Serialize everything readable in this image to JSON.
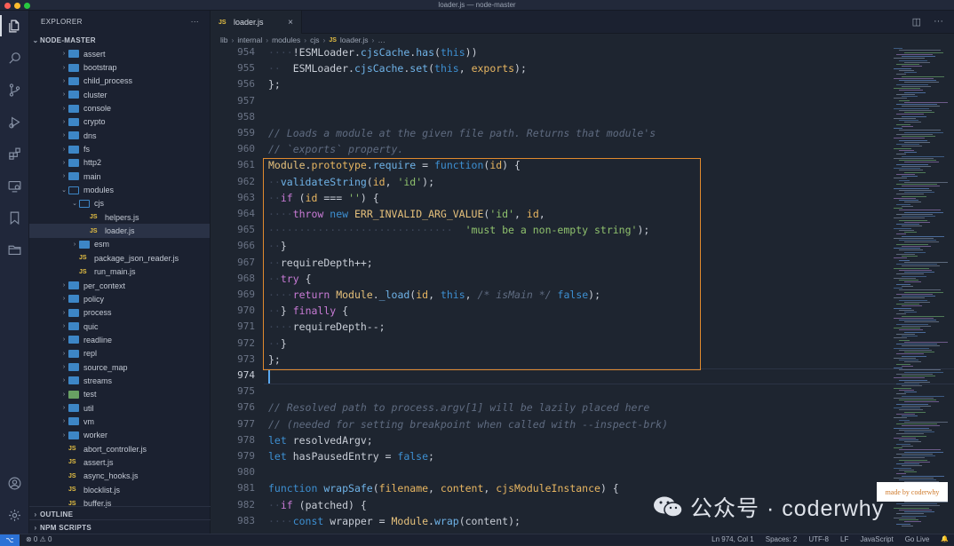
{
  "window": {
    "title": "loader.js — node-master"
  },
  "activity_bar": [
    {
      "icon": "files-icon",
      "active": true
    },
    {
      "icon": "search-icon"
    },
    {
      "icon": "source-control-icon"
    },
    {
      "icon": "run-debug-icon"
    },
    {
      "icon": "extensions-icon"
    },
    {
      "icon": "remote-explorer-icon"
    },
    {
      "icon": "bookmark-icon"
    },
    {
      "icon": "folder-icon"
    },
    {
      "icon": "account-icon"
    },
    {
      "icon": "settings-gear-icon"
    }
  ],
  "sidebar": {
    "title": "EXPLORER",
    "more": "···",
    "root": "NODE-MASTER",
    "outline": "OUTLINE",
    "npm_scripts": "NPM SCRIPTS",
    "tree": [
      {
        "label": "assert",
        "type": "folder",
        "depth": 1,
        "open": false
      },
      {
        "label": "bootstrap",
        "type": "folder",
        "depth": 1,
        "open": false
      },
      {
        "label": "child_process",
        "type": "folder",
        "depth": 1,
        "open": false
      },
      {
        "label": "cluster",
        "type": "folder",
        "depth": 1,
        "open": false
      },
      {
        "label": "console",
        "type": "folder",
        "depth": 1,
        "open": false
      },
      {
        "label": "crypto",
        "type": "folder",
        "depth": 1,
        "open": false
      },
      {
        "label": "dns",
        "type": "folder",
        "depth": 1,
        "open": false
      },
      {
        "label": "fs",
        "type": "folder",
        "depth": 1,
        "open": false
      },
      {
        "label": "http2",
        "type": "folder",
        "depth": 1,
        "open": false
      },
      {
        "label": "main",
        "type": "folder",
        "depth": 1,
        "open": false
      },
      {
        "label": "modules",
        "type": "folder",
        "depth": 1,
        "open": true
      },
      {
        "label": "cjs",
        "type": "folder",
        "depth": 2,
        "open": true
      },
      {
        "label": "helpers.js",
        "type": "js",
        "depth": 3
      },
      {
        "label": "loader.js",
        "type": "js",
        "depth": 3,
        "selected": true
      },
      {
        "label": "esm",
        "type": "folder",
        "depth": 2,
        "open": false
      },
      {
        "label": "package_json_reader.js",
        "type": "js",
        "depth": 2
      },
      {
        "label": "run_main.js",
        "type": "js",
        "depth": 2
      },
      {
        "label": "per_context",
        "type": "folder",
        "depth": 1,
        "open": false
      },
      {
        "label": "policy",
        "type": "folder",
        "depth": 1,
        "open": false
      },
      {
        "label": "process",
        "type": "folder",
        "depth": 1,
        "open": false
      },
      {
        "label": "quic",
        "type": "folder",
        "depth": 1,
        "open": false
      },
      {
        "label": "readline",
        "type": "folder",
        "depth": 1,
        "open": false
      },
      {
        "label": "repl",
        "type": "folder",
        "depth": 1,
        "open": false
      },
      {
        "label": "source_map",
        "type": "folder",
        "depth": 1,
        "open": false
      },
      {
        "label": "streams",
        "type": "folder",
        "depth": 1,
        "open": false
      },
      {
        "label": "test",
        "type": "testfolder",
        "depth": 1,
        "open": false
      },
      {
        "label": "util",
        "type": "folder",
        "depth": 1,
        "open": false
      },
      {
        "label": "vm",
        "type": "folder",
        "depth": 1,
        "open": false
      },
      {
        "label": "worker",
        "type": "folder",
        "depth": 1,
        "open": false
      },
      {
        "label": "abort_controller.js",
        "type": "js",
        "depth": 1
      },
      {
        "label": "assert.js",
        "type": "js",
        "depth": 1
      },
      {
        "label": "async_hooks.js",
        "type": "js",
        "depth": 1
      },
      {
        "label": "blocklist.js",
        "type": "js",
        "depth": 1
      },
      {
        "label": "buffer.js",
        "type": "js",
        "depth": 1
      }
    ]
  },
  "tab": {
    "badge": "JS",
    "label": "loader.js",
    "close": "×"
  },
  "breadcrumb": [
    "lib",
    "internal",
    "modules",
    "cjs",
    "JS",
    "loader.js",
    "…"
  ],
  "editor": {
    "lines": [
      {
        "n": "954",
        "tokens": [
          [
            "dot",
            "····"
          ],
          [
            "p",
            "!"
          ],
          [
            "p",
            "ESMLoader"
          ],
          [
            "p",
            "."
          ],
          [
            "fn",
            "cjsCache"
          ],
          [
            "p",
            "."
          ],
          [
            "fn",
            "has"
          ],
          [
            "p",
            "("
          ],
          [
            "kw",
            "this"
          ],
          [
            "p",
            "))"
          ]
        ]
      },
      {
        "n": "955",
        "tokens": [
          [
            "dot",
            "··"
          ],
          [
            "p",
            "  ESMLoader"
          ],
          [
            "p",
            "."
          ],
          [
            "fn",
            "cjsCache"
          ],
          [
            "p",
            "."
          ],
          [
            "fn",
            "set"
          ],
          [
            "p",
            "("
          ],
          [
            "kw",
            "this"
          ],
          [
            "p",
            ", "
          ],
          [
            "pr",
            "exports"
          ],
          [
            "p",
            ");"
          ]
        ]
      },
      {
        "n": "956",
        "tokens": [
          [
            "p",
            "};"
          ]
        ]
      },
      {
        "n": "957",
        "tokens": []
      },
      {
        "n": "958",
        "tokens": []
      },
      {
        "n": "959",
        "tokens": [
          [
            "cm",
            "// Loads a module at the given file path. Returns that module's"
          ]
        ]
      },
      {
        "n": "960",
        "tokens": [
          [
            "cm",
            "// `exports` property."
          ]
        ]
      },
      {
        "n": "961",
        "tokens": [
          [
            "cls",
            "Module"
          ],
          [
            "p",
            "."
          ],
          [
            "pr",
            "prototype"
          ],
          [
            "p",
            "."
          ],
          [
            "fn",
            "require"
          ],
          [
            "p",
            " = "
          ],
          [
            "kw",
            "function"
          ],
          [
            "p",
            "("
          ],
          [
            "pr",
            "id"
          ],
          [
            "p",
            ") {"
          ]
        ]
      },
      {
        "n": "962",
        "tokens": [
          [
            "dot",
            "··"
          ],
          [
            "fn",
            "validateString"
          ],
          [
            "p",
            "("
          ],
          [
            "pr",
            "id"
          ],
          [
            "p",
            ", "
          ],
          [
            "str",
            "'id'"
          ],
          [
            "p",
            ");"
          ]
        ]
      },
      {
        "n": "963",
        "tokens": [
          [
            "dot",
            "··"
          ],
          [
            "ctl",
            "if"
          ],
          [
            "p",
            " ("
          ],
          [
            "pr",
            "id"
          ],
          [
            "p",
            " === "
          ],
          [
            "str",
            "''"
          ],
          [
            "p",
            ") {"
          ]
        ]
      },
      {
        "n": "964",
        "tokens": [
          [
            "dot",
            "····"
          ],
          [
            "ctl",
            "throw"
          ],
          [
            "p",
            " "
          ],
          [
            "kw",
            "new"
          ],
          [
            "p",
            " "
          ],
          [
            "cls",
            "ERR_INVALID_ARG_VALUE"
          ],
          [
            "p",
            "("
          ],
          [
            "str",
            "'id'"
          ],
          [
            "p",
            ", "
          ],
          [
            "pr",
            "id"
          ],
          [
            "p",
            ","
          ]
        ]
      },
      {
        "n": "965",
        "tokens": [
          [
            "dot",
            "······························"
          ],
          [
            "p",
            "  "
          ],
          [
            "str",
            "'must be a non-empty string'"
          ],
          [
            "p",
            ");"
          ]
        ]
      },
      {
        "n": "966",
        "tokens": [
          [
            "dot",
            "··"
          ],
          [
            "p",
            "}"
          ]
        ]
      },
      {
        "n": "967",
        "tokens": [
          [
            "dot",
            "··"
          ],
          [
            "p",
            "requireDepth++;"
          ]
        ]
      },
      {
        "n": "968",
        "tokens": [
          [
            "dot",
            "··"
          ],
          [
            "ctl",
            "try"
          ],
          [
            "p",
            " {"
          ]
        ]
      },
      {
        "n": "969",
        "tokens": [
          [
            "dot",
            "····"
          ],
          [
            "ctl",
            "return"
          ],
          [
            "p",
            " "
          ],
          [
            "cls",
            "Module"
          ],
          [
            "p",
            "."
          ],
          [
            "fn",
            "_load"
          ],
          [
            "p",
            "("
          ],
          [
            "pr",
            "id"
          ],
          [
            "p",
            ", "
          ],
          [
            "kw",
            "this"
          ],
          [
            "p",
            ", "
          ],
          [
            "cm",
            "/* isMain */"
          ],
          [
            "p",
            " "
          ],
          [
            "kw",
            "false"
          ],
          [
            "p",
            ");"
          ]
        ]
      },
      {
        "n": "970",
        "tokens": [
          [
            "dot",
            "··"
          ],
          [
            "p",
            "} "
          ],
          [
            "ctl",
            "finally"
          ],
          [
            "p",
            " {"
          ]
        ]
      },
      {
        "n": "971",
        "tokens": [
          [
            "dot",
            "····"
          ],
          [
            "p",
            "requireDepth--;"
          ]
        ]
      },
      {
        "n": "972",
        "tokens": [
          [
            "dot",
            "··"
          ],
          [
            "p",
            "}"
          ]
        ]
      },
      {
        "n": "973",
        "tokens": [
          [
            "p",
            "};"
          ]
        ]
      },
      {
        "n": "974",
        "tokens": []
      },
      {
        "n": "975",
        "tokens": []
      },
      {
        "n": "976",
        "tokens": [
          [
            "cm",
            "// Resolved path to process.argv[1] will be lazily placed here"
          ]
        ]
      },
      {
        "n": "977",
        "tokens": [
          [
            "cm",
            "// (needed for setting breakpoint when called with --inspect-brk)"
          ]
        ]
      },
      {
        "n": "978",
        "tokens": [
          [
            "kw",
            "let"
          ],
          [
            "p",
            " resolvedArgv;"
          ]
        ]
      },
      {
        "n": "979",
        "tokens": [
          [
            "kw",
            "let"
          ],
          [
            "p",
            " hasPausedEntry = "
          ],
          [
            "kw",
            "false"
          ],
          [
            "p",
            ";"
          ]
        ]
      },
      {
        "n": "980",
        "tokens": []
      },
      {
        "n": "981",
        "tokens": [
          [
            "kw",
            "function"
          ],
          [
            "p",
            " "
          ],
          [
            "fn",
            "wrapSafe"
          ],
          [
            "p",
            "("
          ],
          [
            "pr",
            "filename"
          ],
          [
            "p",
            ", "
          ],
          [
            "pr",
            "content"
          ],
          [
            "p",
            ", "
          ],
          [
            "pr",
            "cjsModuleInstance"
          ],
          [
            "p",
            ") {"
          ]
        ]
      },
      {
        "n": "982",
        "tokens": [
          [
            "dot",
            "··"
          ],
          [
            "ctl",
            "if"
          ],
          [
            "p",
            " (patched) {"
          ]
        ]
      },
      {
        "n": "983",
        "tokens": [
          [
            "dot",
            "····"
          ],
          [
            "kw",
            "const"
          ],
          [
            "p",
            " wrapper = "
          ],
          [
            "cls",
            "Module"
          ],
          [
            "p",
            "."
          ],
          [
            "fn",
            "wrap"
          ],
          [
            "p",
            "(content);"
          ]
        ]
      }
    ],
    "current_line": "974"
  },
  "watermark": {
    "text": "公众号 · coderwhy",
    "made_by": "made by coderwhy"
  },
  "status": {
    "problems": "⊗ 0 ⚠ 0",
    "right": [
      "Ln 974, Col 1",
      "Spaces: 2",
      "UTF-8",
      "LF",
      "JavaScript",
      "Go Live"
    ]
  },
  "colors": {
    "accent": "#2c72d6",
    "highlight_box": "#e08a2e",
    "folder": "#3d86c6",
    "js_badge": "#e5c043"
  }
}
